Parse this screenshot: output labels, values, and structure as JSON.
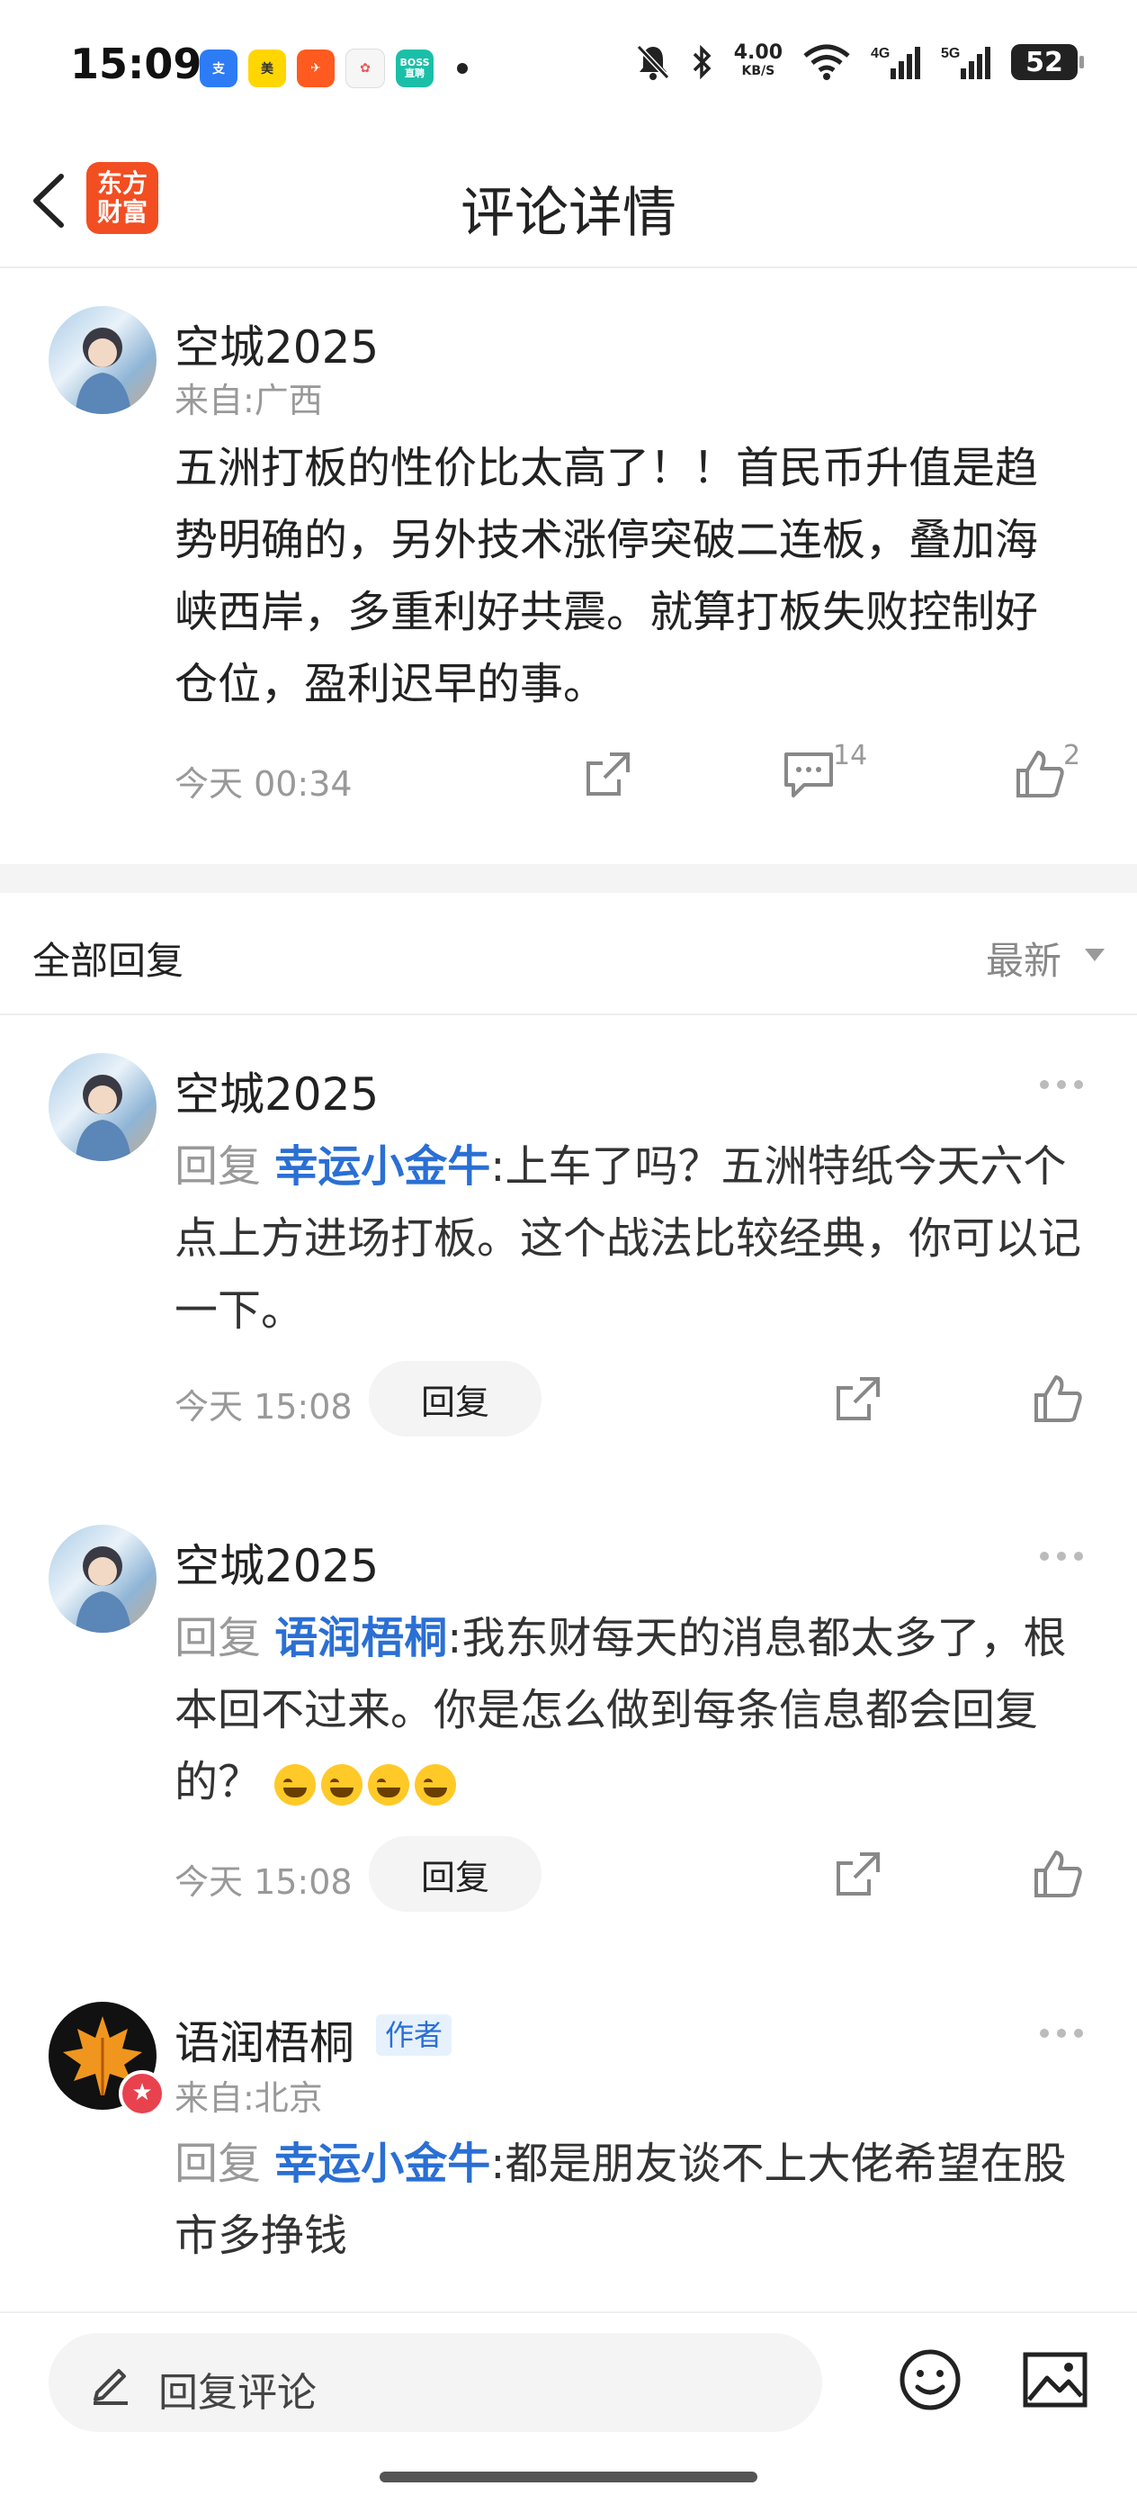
{
  "status": {
    "time": "15:09",
    "net_speed_value": "4.00",
    "net_speed_unit": "KB/S",
    "battery": "52",
    "app_icons": [
      "alipay-icon",
      "meituan-icon",
      "flash-icon",
      "photos-icon",
      "boss-icon"
    ],
    "boss_label": "BOSS 直聘"
  },
  "header": {
    "title": "评论详情",
    "logo_text": "东方财富"
  },
  "post": {
    "username": "空城2025",
    "location": "来自:广西",
    "content": "五洲打板的性价比太高了！！首民币升值是趋势明确的，另外技术涨停突破二连板，叠加海峡西岸，多重利好共震。就算打板失败控制好仓位，盈利迟早的事。",
    "time": "今天 00:34",
    "comment_count": "14",
    "like_count": "2"
  },
  "replies_header": {
    "title": "全部回复",
    "sort": "最新"
  },
  "replies": [
    {
      "username": "空城2025",
      "prefix": "回复",
      "target": "幸运小金牛",
      "text": ":上车了吗？五洲特纸今天六个点上方进场打板。这个战法比较经典，你可以记一下。",
      "time": "今天 15:08",
      "reply_label": "回复"
    },
    {
      "username": "空城2025",
      "prefix": "回复",
      "target": "语润梧桐",
      "text": ":我东财每天的消息都太多了，根本回不过来。你是怎么做到每条信息都会回复的？",
      "time": "今天 15:08",
      "reply_label": "回复"
    },
    {
      "username": "语润梧桐",
      "badge": "作者",
      "location": "来自:北京",
      "prefix": "回复",
      "target": "幸运小金牛",
      "text": ":都是朋友谈不上大佬希望在股市多挣钱"
    }
  ],
  "bottom_bar": {
    "input_placeholder": "回复评论"
  },
  "colors": {
    "accent_blue": "#2a6fd4",
    "brand_orange": "#f24e22",
    "muted_gray": "#999999"
  }
}
